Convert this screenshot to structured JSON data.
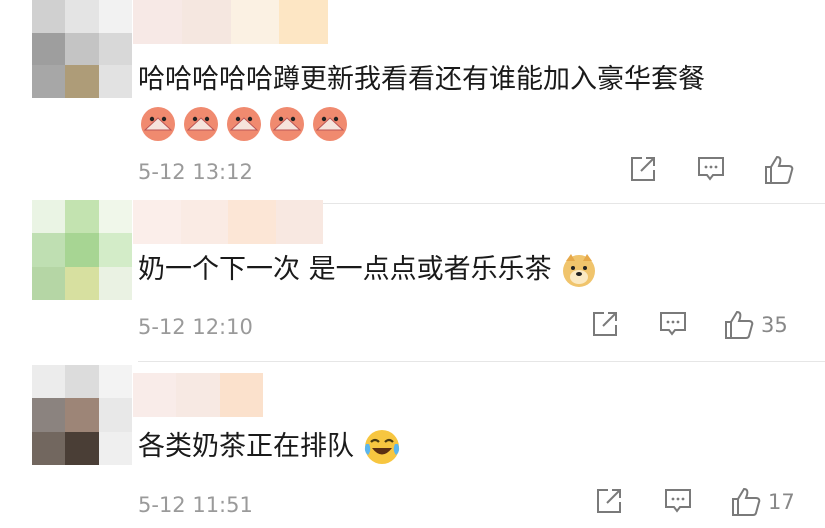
{
  "comments": [
    {
      "text": "哈哈哈哈哈蹲更新我看看还有谁能加入豪华套餐",
      "emoji_names": [
        "shrimp-fan-emoji",
        "shrimp-fan-emoji",
        "shrimp-fan-emoji",
        "shrimp-fan-emoji",
        "shrimp-fan-emoji"
      ],
      "time": "5-12 13:12",
      "likes": ""
    },
    {
      "text": "奶一个下一次 是一点点或者乐乐茶",
      "emoji_names": [
        "doge-emoji"
      ],
      "time": "5-12 12:10",
      "likes": "35"
    },
    {
      "text": "各类奶茶正在排队",
      "emoji_names": [
        "laugh-cry-emoji"
      ],
      "time": "5-12 11:51",
      "likes": "17"
    }
  ],
  "colors": {
    "text": "#1a1a1a",
    "meta": "#9a9a9a",
    "icon": "#7a7a7a",
    "divider": "#e6e6e6"
  },
  "icons": [
    "share-icon",
    "comment-icon",
    "like-icon"
  ]
}
